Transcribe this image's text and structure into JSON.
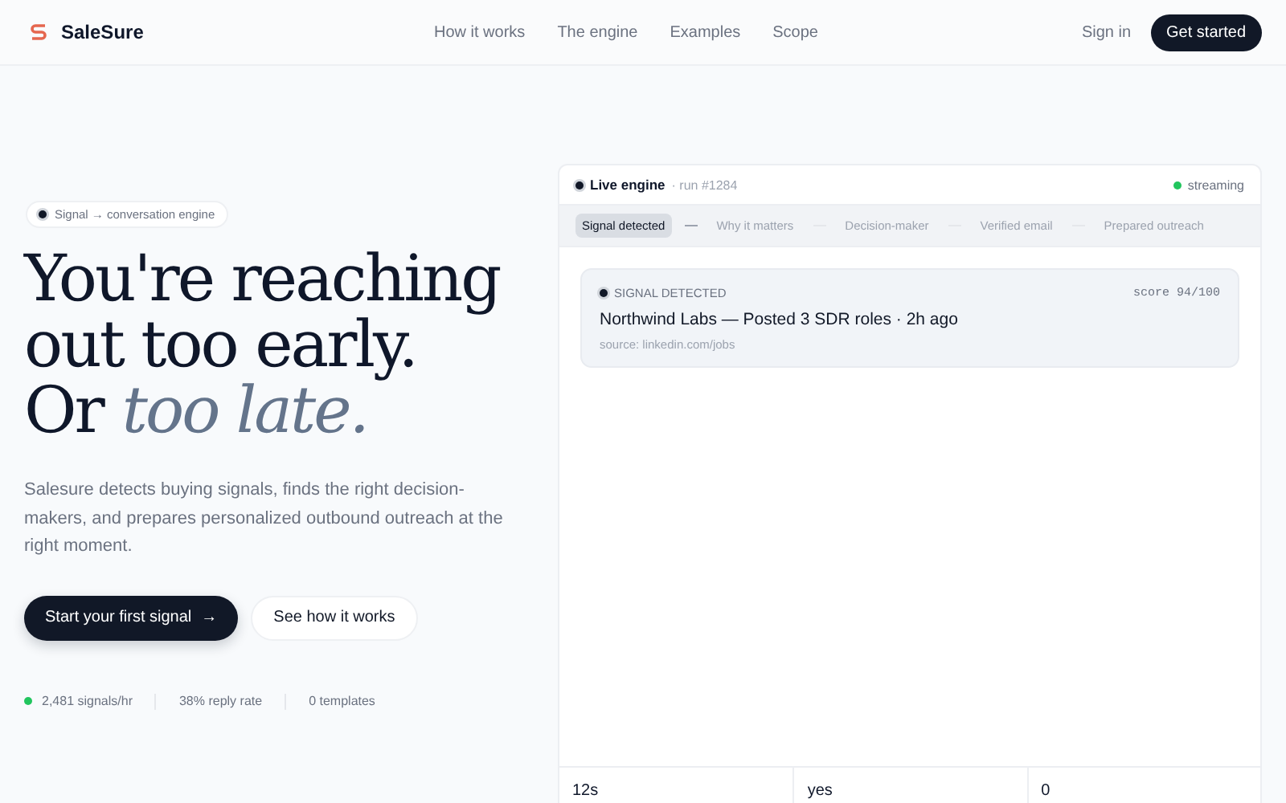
{
  "nav": {
    "brand": "SaleSure",
    "links": [
      "How it works",
      "The engine",
      "Examples",
      "Scope"
    ],
    "sign_in": "Sign in",
    "cta": "Get started"
  },
  "hero": {
    "badge": "Signal → conversation engine",
    "headline_lines": [
      "You're reaching",
      "out too early."
    ],
    "headline_last": "Or",
    "headline_accent": "too late.",
    "lead": "Salesure detects buying signals, finds the right decision-makers, and prepares personalized outbound outreach at the right moment.",
    "primary": "Start your first signal",
    "primary_icon": "→",
    "secondary": "See how it works",
    "stats": [
      {
        "text": "2,481 signals/hr",
        "live": true
      },
      {
        "text": "38% reply rate",
        "live": false
      },
      {
        "text": "0 templates",
        "live": false
      }
    ]
  },
  "engine": {
    "title": "Live engine",
    "run": "· run #1284",
    "status": "streaming",
    "steps": [
      {
        "label": "Signal detected",
        "selected": true
      },
      {
        "label": "Why it matters",
        "selected": false
      },
      {
        "label": "Decision-maker",
        "selected": false
      },
      {
        "label": "Verified email",
        "selected": false
      },
      {
        "label": "Prepared outreach",
        "selected": false
      }
    ],
    "card": {
      "tag": "SIGNAL DETECTED",
      "score": "score 94/100",
      "headline": "Northwind Labs — Posted 3 SDR roles · 2h ago",
      "source": "source: linkedin.com/jobs"
    },
    "metrics": [
      "12s",
      "yes",
      "0"
    ]
  }
}
